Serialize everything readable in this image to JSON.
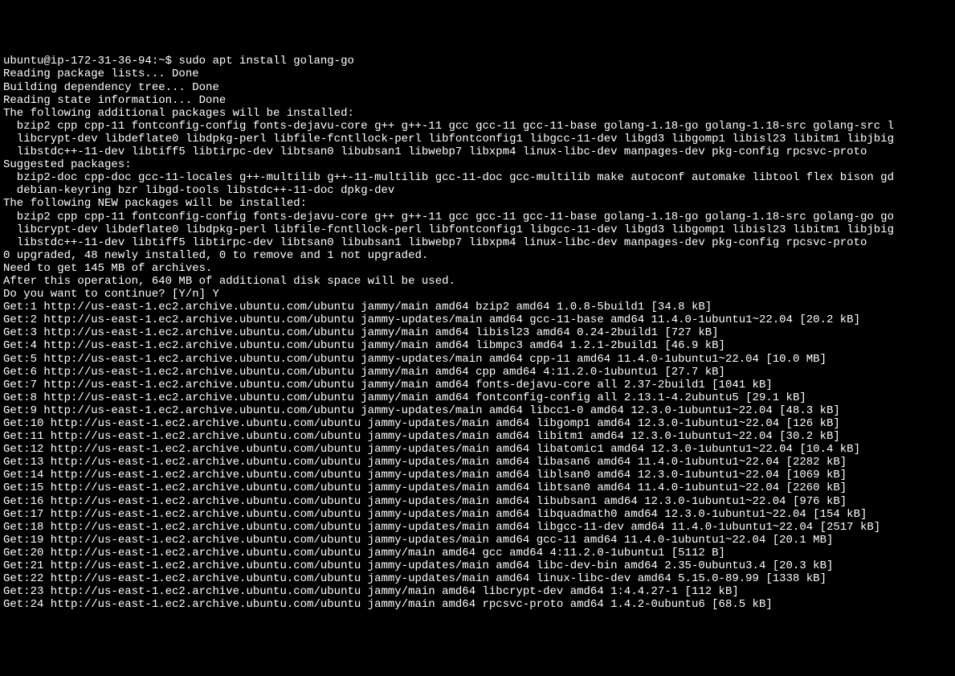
{
  "prompt": "ubuntu@ip-172-31-36-94:~$ ",
  "command": "sudo apt install golang-go",
  "lines": [
    "Reading package lists... Done",
    "Building dependency tree... Done",
    "Reading state information... Done",
    "The following additional packages will be installed:",
    "  bzip2 cpp cpp-11 fontconfig-config fonts-dejavu-core g++ g++-11 gcc gcc-11 gcc-11-base golang-1.18-go golang-1.18-src golang-src l",
    "  libcrypt-dev libdeflate0 libdpkg-perl libfile-fcntllock-perl libfontconfig1 libgcc-11-dev libgd3 libgomp1 libisl23 libitm1 libjbig",
    "  libstdc++-11-dev libtiff5 libtirpc-dev libtsan0 libubsan1 libwebp7 libxpm4 linux-libc-dev manpages-dev pkg-config rpcsvc-proto",
    "Suggested packages:",
    "  bzip2-doc cpp-doc gcc-11-locales g++-multilib g++-11-multilib gcc-11-doc gcc-multilib make autoconf automake libtool flex bison gd",
    "  debian-keyring bzr libgd-tools libstdc++-11-doc dpkg-dev",
    "The following NEW packages will be installed:",
    "  bzip2 cpp cpp-11 fontconfig-config fonts-dejavu-core g++ g++-11 gcc gcc-11 gcc-11-base golang-1.18-go golang-1.18-src golang-go go",
    "  libcrypt-dev libdeflate0 libdpkg-perl libfile-fcntllock-perl libfontconfig1 libgcc-11-dev libgd3 libgomp1 libisl23 libitm1 libjbig",
    "  libstdc++-11-dev libtiff5 libtirpc-dev libtsan0 libubsan1 libwebp7 libxpm4 linux-libc-dev manpages-dev pkg-config rpcsvc-proto",
    "0 upgraded, 48 newly installed, 0 to remove and 1 not upgraded.",
    "Need to get 145 MB of archives.",
    "After this operation, 640 MB of additional disk space will be used.",
    "Do you want to continue? [Y/n] Y",
    "Get:1 http://us-east-1.ec2.archive.ubuntu.com/ubuntu jammy/main amd64 bzip2 amd64 1.0.8-5build1 [34.8 kB]",
    "Get:2 http://us-east-1.ec2.archive.ubuntu.com/ubuntu jammy-updates/main amd64 gcc-11-base amd64 11.4.0-1ubuntu1~22.04 [20.2 kB]",
    "Get:3 http://us-east-1.ec2.archive.ubuntu.com/ubuntu jammy/main amd64 libisl23 amd64 0.24-2build1 [727 kB]",
    "Get:4 http://us-east-1.ec2.archive.ubuntu.com/ubuntu jammy/main amd64 libmpc3 amd64 1.2.1-2build1 [46.9 kB]",
    "Get:5 http://us-east-1.ec2.archive.ubuntu.com/ubuntu jammy-updates/main amd64 cpp-11 amd64 11.4.0-1ubuntu1~22.04 [10.0 MB]",
    "Get:6 http://us-east-1.ec2.archive.ubuntu.com/ubuntu jammy/main amd64 cpp amd64 4:11.2.0-1ubuntu1 [27.7 kB]",
    "Get:7 http://us-east-1.ec2.archive.ubuntu.com/ubuntu jammy/main amd64 fonts-dejavu-core all 2.37-2build1 [1041 kB]",
    "Get:8 http://us-east-1.ec2.archive.ubuntu.com/ubuntu jammy/main amd64 fontconfig-config all 2.13.1-4.2ubuntu5 [29.1 kB]",
    "Get:9 http://us-east-1.ec2.archive.ubuntu.com/ubuntu jammy-updates/main amd64 libcc1-0 amd64 12.3.0-1ubuntu1~22.04 [48.3 kB]",
    "Get:10 http://us-east-1.ec2.archive.ubuntu.com/ubuntu jammy-updates/main amd64 libgomp1 amd64 12.3.0-1ubuntu1~22.04 [126 kB]",
    "Get:11 http://us-east-1.ec2.archive.ubuntu.com/ubuntu jammy-updates/main amd64 libitm1 amd64 12.3.0-1ubuntu1~22.04 [30.2 kB]",
    "Get:12 http://us-east-1.ec2.archive.ubuntu.com/ubuntu jammy-updates/main amd64 libatomic1 amd64 12.3.0-1ubuntu1~22.04 [10.4 kB]",
    "Get:13 http://us-east-1.ec2.archive.ubuntu.com/ubuntu jammy-updates/main amd64 libasan6 amd64 11.4.0-1ubuntu1~22.04 [2282 kB]",
    "Get:14 http://us-east-1.ec2.archive.ubuntu.com/ubuntu jammy-updates/main amd64 liblsan0 amd64 12.3.0-1ubuntu1~22.04 [1069 kB]",
    "Get:15 http://us-east-1.ec2.archive.ubuntu.com/ubuntu jammy-updates/main amd64 libtsan0 amd64 11.4.0-1ubuntu1~22.04 [2260 kB]",
    "Get:16 http://us-east-1.ec2.archive.ubuntu.com/ubuntu jammy-updates/main amd64 libubsan1 amd64 12.3.0-1ubuntu1~22.04 [976 kB]",
    "Get:17 http://us-east-1.ec2.archive.ubuntu.com/ubuntu jammy-updates/main amd64 libquadmath0 amd64 12.3.0-1ubuntu1~22.04 [154 kB]",
    "Get:18 http://us-east-1.ec2.archive.ubuntu.com/ubuntu jammy-updates/main amd64 libgcc-11-dev amd64 11.4.0-1ubuntu1~22.04 [2517 kB]",
    "Get:19 http://us-east-1.ec2.archive.ubuntu.com/ubuntu jammy-updates/main amd64 gcc-11 amd64 11.4.0-1ubuntu1~22.04 [20.1 MB]",
    "Get:20 http://us-east-1.ec2.archive.ubuntu.com/ubuntu jammy/main amd64 gcc amd64 4:11.2.0-1ubuntu1 [5112 B]",
    "Get:21 http://us-east-1.ec2.archive.ubuntu.com/ubuntu jammy-updates/main amd64 libc-dev-bin amd64 2.35-0ubuntu3.4 [20.3 kB]",
    "Get:22 http://us-east-1.ec2.archive.ubuntu.com/ubuntu jammy-updates/main amd64 linux-libc-dev amd64 5.15.0-89.99 [1338 kB]",
    "Get:23 http://us-east-1.ec2.archive.ubuntu.com/ubuntu jammy/main amd64 libcrypt-dev amd64 1:4.4.27-1 [112 kB]",
    "Get:24 http://us-east-1.ec2.archive.ubuntu.com/ubuntu jammy/main amd64 rpcsvc-proto amd64 1.4.2-0ubuntu6 [68.5 kB]"
  ]
}
